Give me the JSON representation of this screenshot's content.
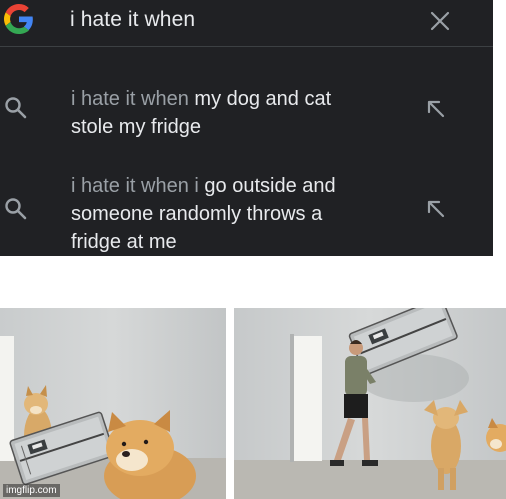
{
  "search": {
    "query": "i hate it when",
    "suggestions": [
      {
        "prefix": "i hate it when",
        "line1_rest": " my dog and cat",
        "line2": "stole my fridge"
      },
      {
        "prefix": "i hate it when i",
        "line1_rest": " go outside and",
        "line2": "someone randomly throws a",
        "line3": "fridge at me"
      }
    ]
  },
  "icons": {
    "logo": "google-g-logo",
    "clear": "close-icon",
    "search": "search-icon",
    "fill": "arrow-up-left-icon"
  },
  "colors": {
    "panel_bg": "#202124",
    "text_primary": "#e8eaed",
    "text_prefix": "#9aa0a6",
    "icon_gray": "#9aa0a6"
  },
  "watermark": "imgflip.com"
}
